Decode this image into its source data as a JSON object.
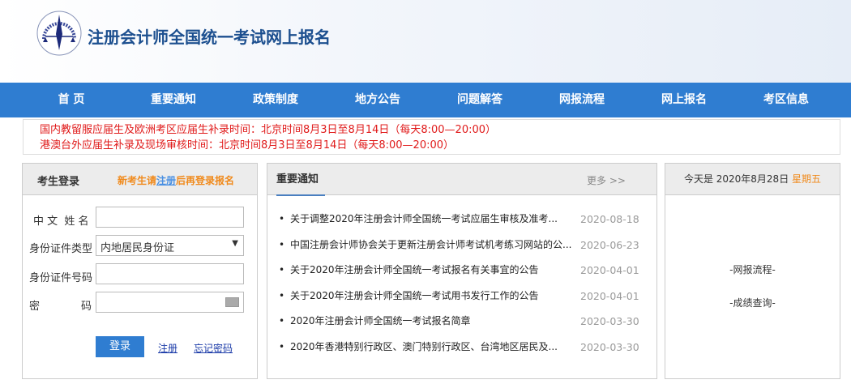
{
  "header": {
    "title": "注册会计师全国统一考试网上报名"
  },
  "nav": [
    "首 页",
    "重要通知",
    "政策制度",
    "地方公告",
    "问题解答",
    "网报流程",
    "网上报名",
    "考区信息"
  ],
  "notices": [
    "国内教留服应届生及欧洲考区应届生补录时间：北京时间8月3日至8月14日（每天8:00—20:00）",
    "港澳台外应届生补录及现场审核时间：北京时间8月3日至8月14日（每天8:00—20:00）"
  ],
  "login": {
    "title": "考生登录",
    "hint_pre": "新考生请",
    "hint_link": "注册",
    "hint_post": "后再登录报名",
    "name_label": "中 文  姓 名",
    "idtype_label": "身份证件类型",
    "idtype_value": "内地居民身份证",
    "idno_label": "身份证件号码",
    "pwd_label_1": "密",
    "pwd_label_2": "码",
    "login_button": "登录",
    "register_link": "注册",
    "forgot_link": "忘记密码"
  },
  "news": {
    "title": "重要通知",
    "more": "更多 >>",
    "items": [
      {
        "title": "关于调整2020年注册会计师全国统一考试应届生审核及准考...",
        "date": "2020-08-18"
      },
      {
        "title": "中国注册会计师协会关于更新注册会计师考试机考练习网站的公...",
        "date": "2020-06-23"
      },
      {
        "title": "关于2020年注册会计师全国统一考试报名有关事宜的公告",
        "date": "2020-04-01"
      },
      {
        "title": "关于2020年注册会计师全国统一考试用书发行工作的公告",
        "date": "2020-04-01"
      },
      {
        "title": "2020年注册会计师全国统一考试报名简章",
        "date": "2020-03-30"
      },
      {
        "title": "2020年香港特别行政区、澳门特别行政区、台湾地区居民及...",
        "date": "2020-03-30"
      }
    ]
  },
  "side": {
    "today_label": "今天是 2020年8月28日",
    "weekday": "星期五",
    "link1": "-网报流程-",
    "link2": "-成绩查询-"
  },
  "colors": {
    "nav": "#2f7dd1",
    "notice": "#e01a1a",
    "accent": "#f08a1c"
  }
}
